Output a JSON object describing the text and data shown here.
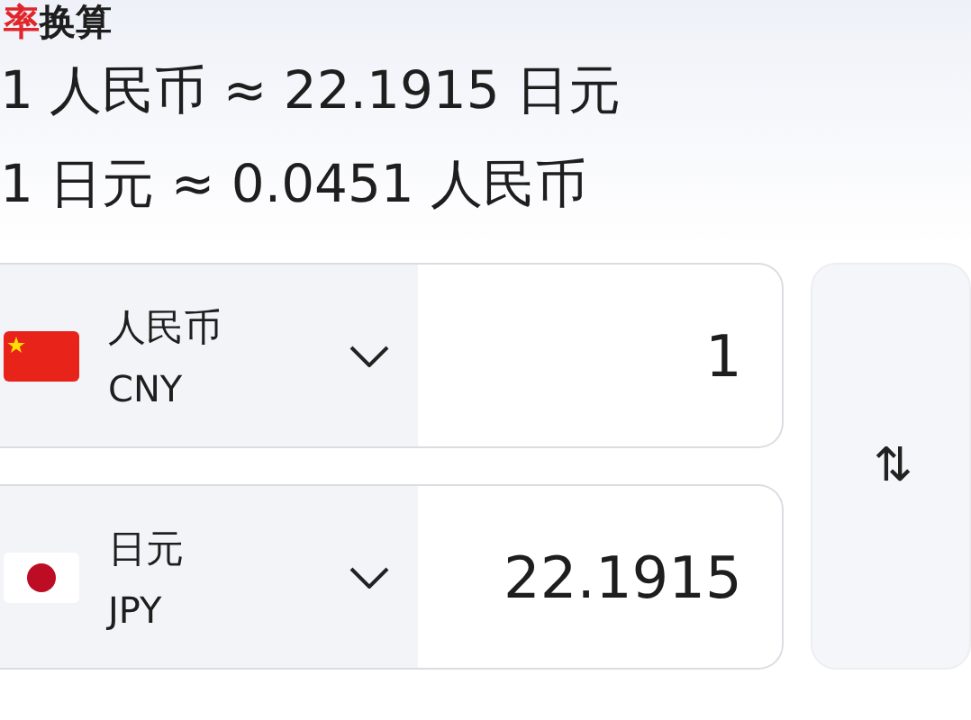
{
  "title": {
    "highlight": "率",
    "rest": "换算"
  },
  "rates": [
    "1 人民币 ≈ 22.1915 日元",
    "1 日元 ≈ 0.0451 人民币"
  ],
  "currencies": [
    {
      "name": "人民币",
      "code": "CNY",
      "kind": "china",
      "amount": "1"
    },
    {
      "name": "日元",
      "code": "JPY",
      "kind": "japan",
      "amount": "22.1915"
    }
  ],
  "swap": {
    "icon": "⇅"
  }
}
